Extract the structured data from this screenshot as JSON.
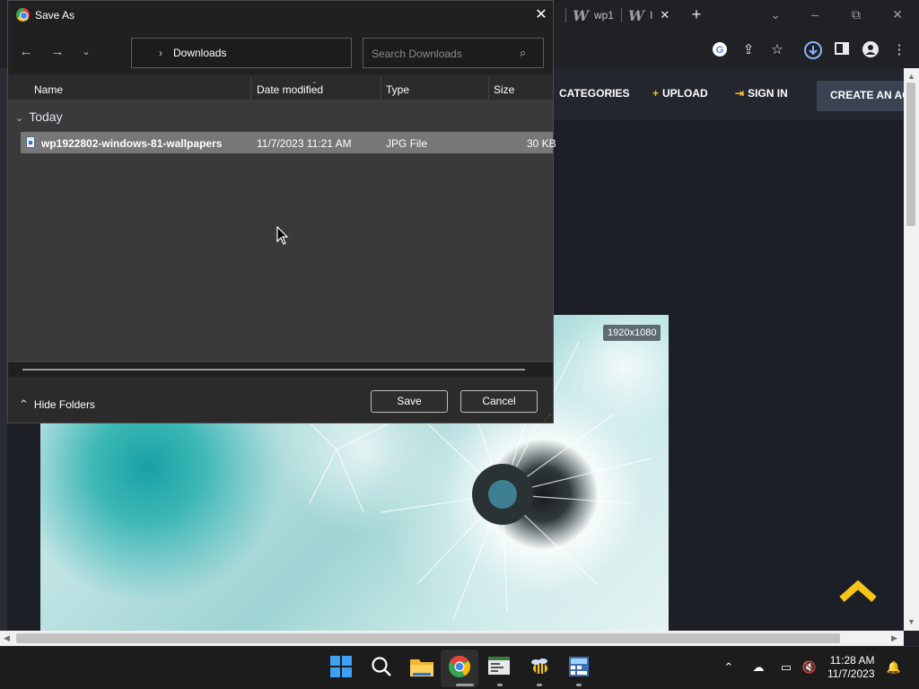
{
  "browser": {
    "tabs": [
      {
        "title": "wp1"
      },
      {
        "title": "I"
      }
    ],
    "new_tab": "+",
    "window_controls": {
      "dropdown": "⌄",
      "minimize": "–",
      "restore": "⧉",
      "close": "✕"
    }
  },
  "site": {
    "nav": {
      "categories": "CATEGORIES",
      "upload": "UPLOAD",
      "upload_prefix": "+",
      "signin": "SIGN IN",
      "create": "CREATE AN AC"
    },
    "wallpaper": {
      "resolution": "1920x1080"
    },
    "accent_color": "#f5c518"
  },
  "dialog": {
    "title": "Save As",
    "address": {
      "chevron": "›",
      "path": "Downloads"
    },
    "search": {
      "placeholder": "Search Downloads"
    },
    "columns": {
      "name": "Name",
      "date": "Date modified",
      "type": "Type",
      "size": "Size"
    },
    "group": {
      "label": "Today",
      "chevron": "⌄"
    },
    "files": [
      {
        "name": "wp1922802-windows-81-wallpapers",
        "date": "11/7/2023 11:21 AM",
        "type": "JPG File",
        "size": "30 KB"
      }
    ],
    "hide_folders": "Hide Folders",
    "save_label": "Save",
    "cancel_label": "Cancel"
  },
  "taskbar": {
    "time": "11:28 AM",
    "date": "11/7/2023"
  }
}
